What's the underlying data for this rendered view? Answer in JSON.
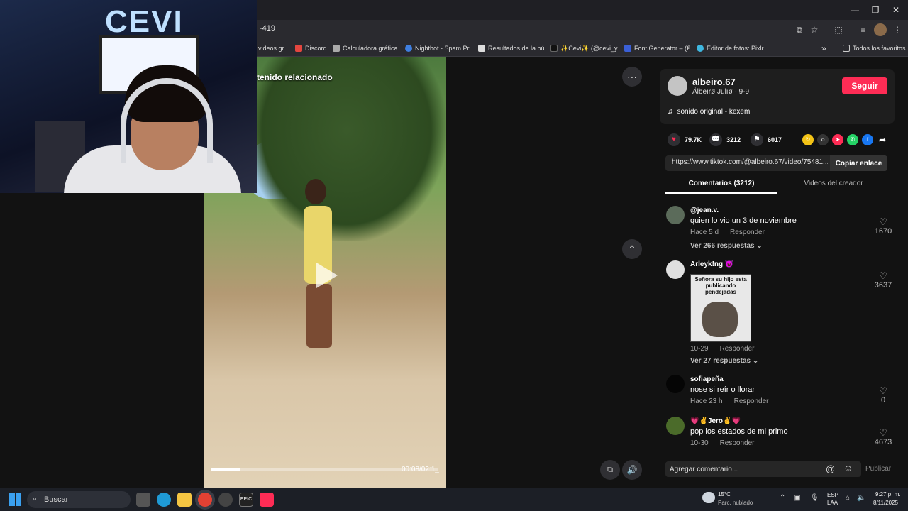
{
  "browser": {
    "url_fragment": "-419",
    "bookmarks": [
      {
        "label": "videos gr...",
        "color": "#888888"
      },
      {
        "label": "Discord",
        "color": "#e4463f"
      },
      {
        "label": "Calculadora gráfica...",
        "color": "#aaaaaa"
      },
      {
        "label": "Nightbot - Spam Pr...",
        "color": "#3f7fe0"
      },
      {
        "label": "Resultados de la bú...",
        "color": "#dddddd"
      },
      {
        "label": "✨Cevi✨ (@cevi_y...",
        "color": "#111111"
      },
      {
        "label": "Font Generator – (€...",
        "color": "#3a5fd6"
      },
      {
        "label": "Editor de fotos: Pixlr...",
        "color": "#3fb7e0"
      }
    ],
    "all_bookmarks": "Todos los favoritos",
    "overflow": "»"
  },
  "webcam": {
    "sign_text": "CEVI"
  },
  "video": {
    "related_label": "tenido relacionado",
    "time": "00:08/02:1_",
    "more_icon": "···",
    "scroll_up_icon": "⌃"
  },
  "creator": {
    "username": "albeiro.67",
    "subline": "Älbëïrø Jülïø · 9-9",
    "follow_label": "Seguir",
    "sound": "sonido original - kexem"
  },
  "stats": {
    "likes": "79.7K",
    "comments": "3212",
    "saves": "6017"
  },
  "link": {
    "url": "https://www.tiktok.com/@albeiro.67/video/75481...",
    "copy_label": "Copiar enlace"
  },
  "tabs": {
    "comments": "Comentarios (3212)",
    "creator_videos": "Videos del creador"
  },
  "comments": [
    {
      "user": "@jean.v.",
      "text": "quien lo vio un 3 de noviembre",
      "time": "Hace 5 d",
      "reply": "Responder",
      "replies": "Ver 266 respuestas",
      "likes": "1670"
    },
    {
      "user": "Arleyk!ng 👿",
      "text": "",
      "time": "10-29",
      "reply": "Responder",
      "replies": "Ver 27 respuestas",
      "likes": "3637",
      "image_text": "Señora su hijo esta publicando pendejadas"
    },
    {
      "user": "sofiapeña",
      "text": "nose si reír o llorar",
      "time": "Hace 23 h",
      "reply": "Responder",
      "likes": "0"
    },
    {
      "user": "💗✌️Jero✌️💗",
      "text": "pop los estados de mi primo",
      "time": "10-30",
      "reply": "Responder",
      "likes": "4673"
    }
  ],
  "comment_box": {
    "placeholder": "Agregar comentario...",
    "publish": "Publicar"
  },
  "taskbar": {
    "search": "Buscar",
    "temp": "15°C",
    "weather": "Parc. nublado",
    "lang1": "ESP",
    "lang2": "LAA",
    "time": "9:27 p. m.",
    "date": "8/11/2025"
  }
}
